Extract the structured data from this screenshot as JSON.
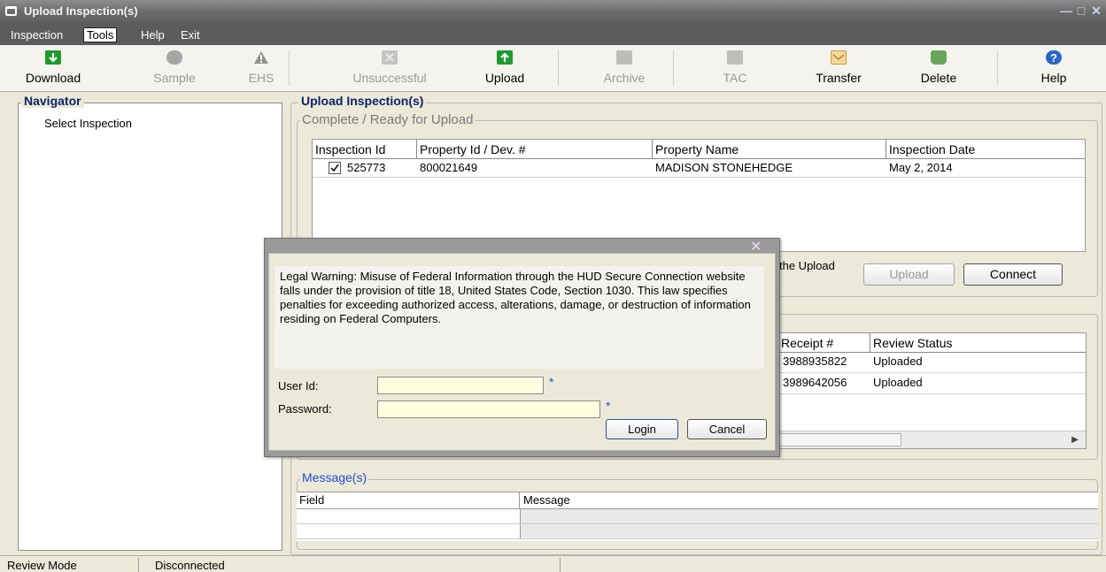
{
  "window": {
    "title": "Upload Inspection(s)"
  },
  "menu": [
    "Inspection",
    "Tools",
    "Help",
    "Exit"
  ],
  "toolbar": [
    {
      "label": "Download",
      "icon": "download-icon",
      "enabled": true,
      "color": "#1e9a2e"
    },
    {
      "label": "Sample",
      "icon": "sample-icon",
      "enabled": false,
      "color": "#9a9a9a"
    },
    {
      "label": "EHS",
      "icon": "ehs-warning-icon",
      "enabled": false,
      "color": "#9a9a9a"
    },
    {
      "label": "Unsuccessful",
      "icon": "unsuccessful-icon",
      "enabled": false,
      "color": "#b3b3b3"
    },
    {
      "label": "Upload",
      "icon": "upload-icon",
      "enabled": true,
      "color": "#1e9a2e"
    },
    {
      "label": "Archive",
      "icon": "archive-icon",
      "enabled": false,
      "color": "#b3b3b3"
    },
    {
      "label": "TAC",
      "icon": "tac-icon",
      "enabled": false,
      "color": "#b3b3b3"
    },
    {
      "label": "Transfer",
      "icon": "transfer-icon",
      "enabled": true,
      "color": "#d8a33c"
    },
    {
      "label": "Delete",
      "icon": "delete-icon",
      "enabled": true,
      "color": "#5aa04a"
    },
    {
      "label": "Help",
      "icon": "help-icon",
      "enabled": true,
      "color": "#2a66c8"
    }
  ],
  "navigator": {
    "title": "Navigator",
    "items": [
      "Select Inspection"
    ]
  },
  "main": {
    "title": "Upload Inspection(s)",
    "ready_group": {
      "legend": "Complete / Ready for Upload",
      "columns": [
        "Inspection Id",
        "Property Id / Dev. #",
        "Property Name",
        "Inspection Date"
      ],
      "rows": [
        {
          "checked": true,
          "inspection_id": "525773",
          "property_id": "800021649",
          "property_name": "MADISON STONEHEDGE",
          "inspection_date": "May 2, 2014"
        }
      ],
      "partial_text": "the Upload",
      "upload_button": "Upload",
      "connect_button": "Connect"
    },
    "uploaded_group": {
      "columns": [
        "Receipt #",
        "Review Status"
      ],
      "rows": [
        {
          "receipt": "3988935822",
          "status": "Uploaded"
        },
        {
          "receipt": "3989642056",
          "status": "Uploaded"
        }
      ]
    },
    "messages": {
      "legend": "Message(s)",
      "columns": [
        "Field",
        "Message"
      ]
    }
  },
  "dialog": {
    "warning": "Legal Warning: Misuse of Federal Information through the HUD Secure Connection website falls under the provision of title 18, United States Code, Section 1030. This law specifies penalties for exceeding authorized access, alterations, damage, or destruction of information residing on Federal Computers.",
    "user_label": "User Id:",
    "password_label": "Password:",
    "required_mark": "*",
    "login_button": "Login",
    "cancel_button": "Cancel",
    "user_value": "",
    "password_value": ""
  },
  "status": {
    "mode": "Review Mode",
    "connection": "Disconnected"
  }
}
